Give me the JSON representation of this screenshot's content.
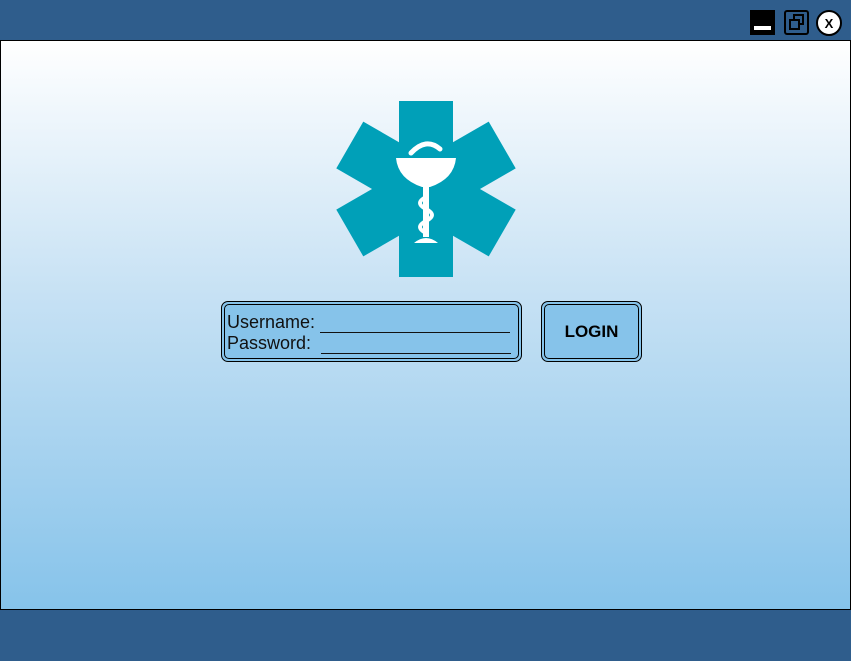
{
  "window": {
    "close_label": "X"
  },
  "login_form": {
    "username_label": "Username:",
    "password_label": "Password:",
    "login_label": "LOGIN"
  },
  "colors": {
    "titlebar": "#2f5d8c",
    "logo": "#00a0b8",
    "field_bg": "#86c3ea"
  },
  "icons": {
    "logo": "star-of-life-icon",
    "minimize": "minimize-icon",
    "maximize": "restore-icon",
    "close": "close-icon"
  }
}
